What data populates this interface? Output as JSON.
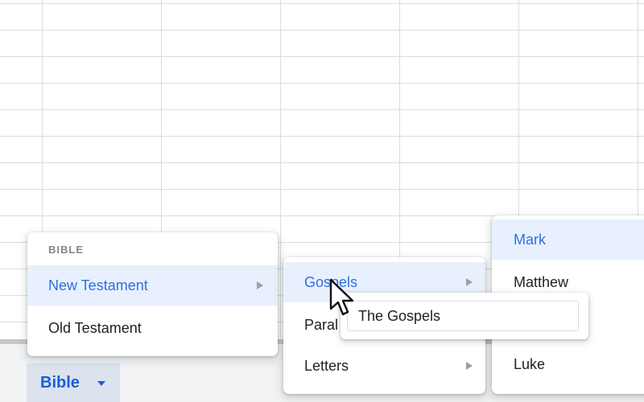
{
  "sheet_tab": {
    "label": "Bible",
    "accent": "#1a5fd6",
    "caret_icon": "caret-down-icon"
  },
  "menu_level1": {
    "header": "BIBLE",
    "items": [
      {
        "label": "New Testament",
        "active": true,
        "has_submenu": true
      },
      {
        "label": "Old Testament",
        "active": false,
        "has_submenu": false
      }
    ]
  },
  "menu_level2": {
    "items": [
      {
        "label": "Gospels",
        "active": true,
        "has_submenu": true
      },
      {
        "label": "Paral",
        "active": false,
        "has_submenu": false
      },
      {
        "label": "Letters",
        "active": false,
        "has_submenu": true
      }
    ]
  },
  "menu_level3": {
    "items": [
      {
        "label": "Mark",
        "active": true
      },
      {
        "label": "Matthew",
        "active": false
      },
      {
        "label": "Luke",
        "active": false
      }
    ]
  },
  "tooltip": {
    "text": "The Gospels"
  },
  "colors": {
    "active_bg": "#e8f0fe",
    "active_text": "#2f6fe0",
    "grid_line": "#dadce0"
  }
}
